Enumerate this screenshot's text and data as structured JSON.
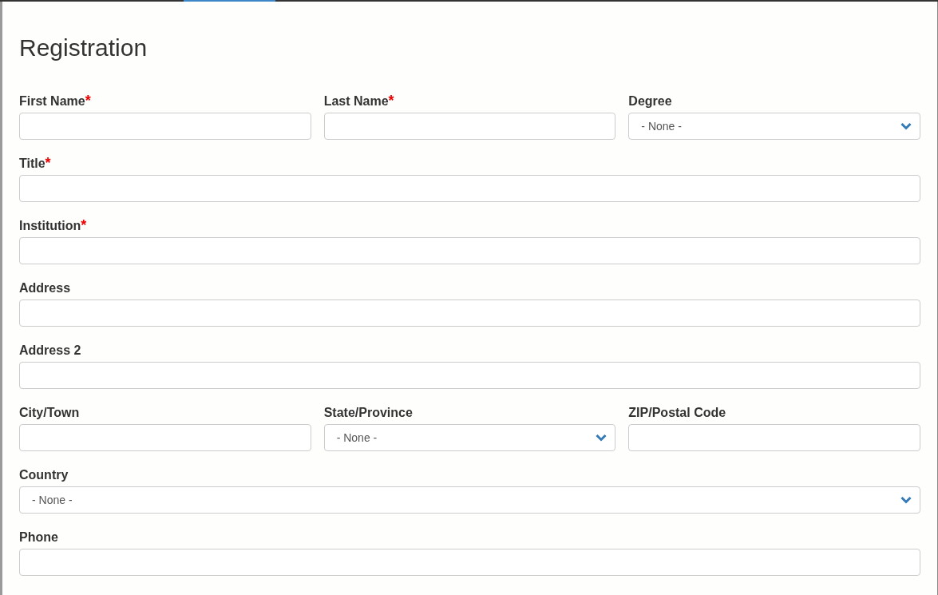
{
  "title": "Registration",
  "rows": [
    {
      "fields": [
        {
          "label": "First Name",
          "required_mark": "*",
          "kind": "text"
        },
        {
          "label": "Last Name",
          "required_mark": "*",
          "kind": "text"
        },
        {
          "label": "Degree",
          "kind": "select",
          "value": "- None -"
        }
      ]
    },
    {
      "fields": [
        {
          "label": "Title",
          "required_mark": "*",
          "kind": "text"
        }
      ]
    },
    {
      "fields": [
        {
          "label": "Institution",
          "required_mark": "*",
          "kind": "text"
        }
      ]
    },
    {
      "fields": [
        {
          "label": "Address",
          "kind": "text"
        }
      ]
    },
    {
      "fields": [
        {
          "label": "Address 2",
          "kind": "text"
        }
      ]
    },
    {
      "fields": [
        {
          "label": "City/Town",
          "kind": "text"
        },
        {
          "label": "State/Province",
          "kind": "select",
          "value": "- None -"
        },
        {
          "label": "ZIP/Postal Code",
          "kind": "text"
        }
      ]
    },
    {
      "fields": [
        {
          "label": "Country",
          "kind": "select",
          "value": "- None -"
        }
      ]
    },
    {
      "fields": [
        {
          "label": "Phone",
          "kind": "text"
        }
      ]
    }
  ]
}
